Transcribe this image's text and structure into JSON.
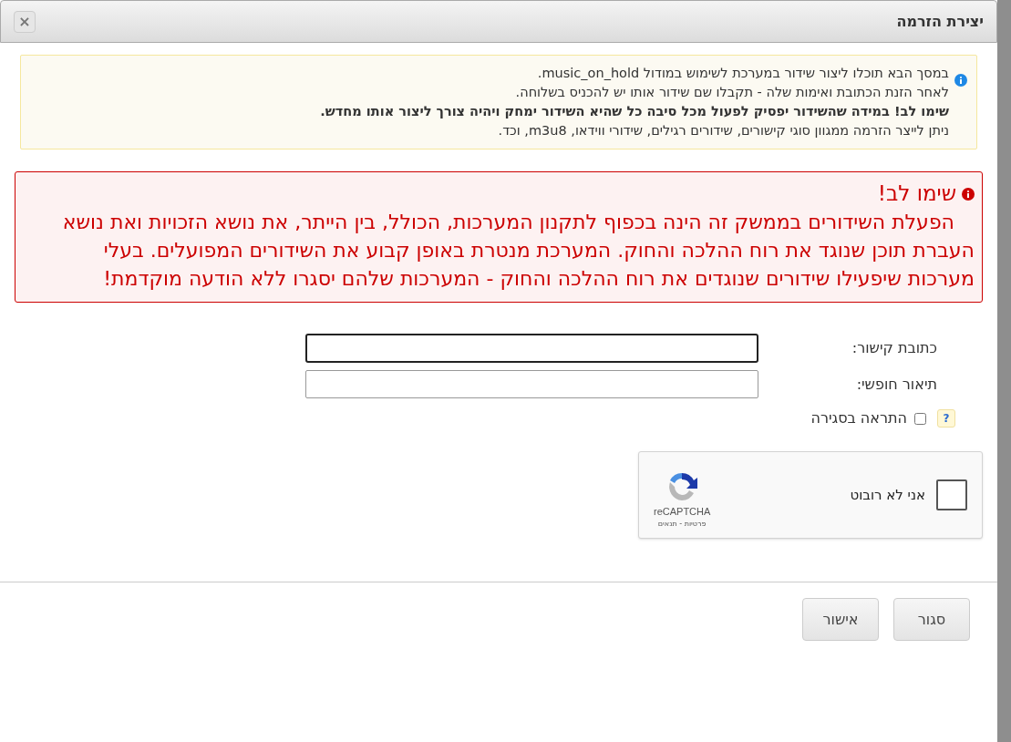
{
  "dialog": {
    "title": "יצירת הזרמה",
    "close_icon": "×"
  },
  "info": {
    "lines": [
      {
        "kind": "plain",
        "text": "במסך הבא תוכלו ליצור שידור במערכת לשימוש במודול music_on_hold."
      },
      {
        "kind": "plain",
        "text": "לאחר הזנת הכתובת ואימות שלה - תקבלו שם שידור אותו יש להכניס בשלוחה."
      },
      {
        "kind": "bold",
        "text": "שימו לב! במידה שהשידור יפסיק לפעול מכל סיבה כל שהיא השידור ימחק ויהיה צורך ליצור אותו מחדש."
      },
      {
        "kind": "plain",
        "text": "ניתן לייצר הזרמה ממגוון סוגי קישורים, שידורים רגילים, שידורי ווידאו, m3u8, וכד."
      }
    ]
  },
  "warning": {
    "title": "שימו לב!",
    "text": "הפעלת השידורים בממשק זה הינה בכפוף לתקנון המערכות, הכולל, בין הייתר, את נושא הזכויות ואת נושא העברת תוכן שנוגד את רוח ההלכה והחוק. המערכת מנטרת באופן קבוע את השידורים המפועלים. בעלי מערכות שיפעילו שידורים שנוגדים את רוח ההלכה והחוק - המערכות שלהם יסגרו ללא הודעה מוקדמת!"
  },
  "fields": [
    {
      "label": "כתובת קישור:",
      "focused": true
    },
    {
      "label": "תיאור חופשי:",
      "focused": false
    }
  ],
  "close_alert": {
    "label": "התראה בסגירה",
    "checked": false,
    "help": "?"
  },
  "captcha": {
    "label": "אני לא רובוט",
    "checked": false,
    "brand": "reCAPTCHA",
    "links": "פרטיות - תנאים"
  },
  "buttons": [
    {
      "label": "סגור"
    },
    {
      "label": "אישור"
    }
  ]
}
